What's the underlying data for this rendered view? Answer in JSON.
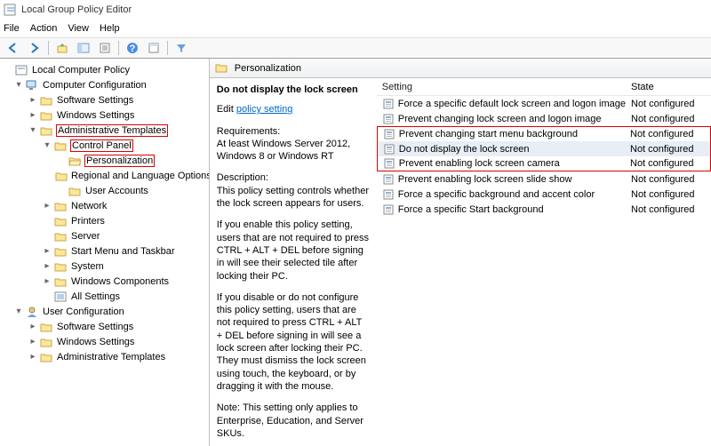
{
  "window": {
    "title": "Local Group Policy Editor"
  },
  "menu": {
    "file": "File",
    "action": "Action",
    "view": "View",
    "help": "Help"
  },
  "tree": {
    "root": "Local Computer Policy",
    "cc": "Computer Configuration",
    "ss": "Software Settings",
    "ws": "Windows Settings",
    "at": "Administrative Templates",
    "cp": "Control Panel",
    "pers": "Personalization",
    "reg": "Regional and Language Options",
    "ua": "User Accounts",
    "net": "Network",
    "prt": "Printers",
    "srv": "Server",
    "smt": "Start Menu and Taskbar",
    "sys": "System",
    "wc": "Windows Components",
    "alls": "All Settings",
    "uc": "User Configuration",
    "uss": "Software Settings",
    "uws": "Windows Settings",
    "uat": "Administrative Templates"
  },
  "right": {
    "header": "Personalization",
    "selected_policy": "Do not display the lock screen",
    "edit_text": "Edit",
    "edit_link": "policy setting",
    "req_label": "Requirements:",
    "req_text": "At least Windows Server 2012, Windows 8 or Windows RT",
    "desc_label": "Description:",
    "desc1": "This policy setting controls whether the lock screen appears for users.",
    "desc2": "If you enable this policy setting, users that are not required to press CTRL + ALT + DEL before signing in will see their selected tile after locking their PC.",
    "desc3": "If you disable or do not configure this policy setting, users that are not required to press CTRL + ALT + DEL before signing in will see a lock screen after locking their PC. They must dismiss the lock screen using touch, the keyboard, or by dragging it with the mouse.",
    "desc4": "Note: This setting only applies to Enterprise, Education, and Server SKUs."
  },
  "cols": {
    "setting": "Setting",
    "state": "State"
  },
  "policies": [
    {
      "name": "Force a specific default lock screen and logon image",
      "state": "Not configured"
    },
    {
      "name": "Prevent changing lock screen and logon image",
      "state": "Not configured"
    },
    {
      "name": "Prevent changing start menu background",
      "state": "Not configured"
    },
    {
      "name": "Do not display the lock screen",
      "state": "Not configured"
    },
    {
      "name": "Prevent enabling lock screen camera",
      "state": "Not configured"
    },
    {
      "name": "Prevent enabling lock screen slide show",
      "state": "Not configured"
    },
    {
      "name": "Force a specific background and accent color",
      "state": "Not configured"
    },
    {
      "name": "Force a specific Start background",
      "state": "Not configured"
    }
  ]
}
